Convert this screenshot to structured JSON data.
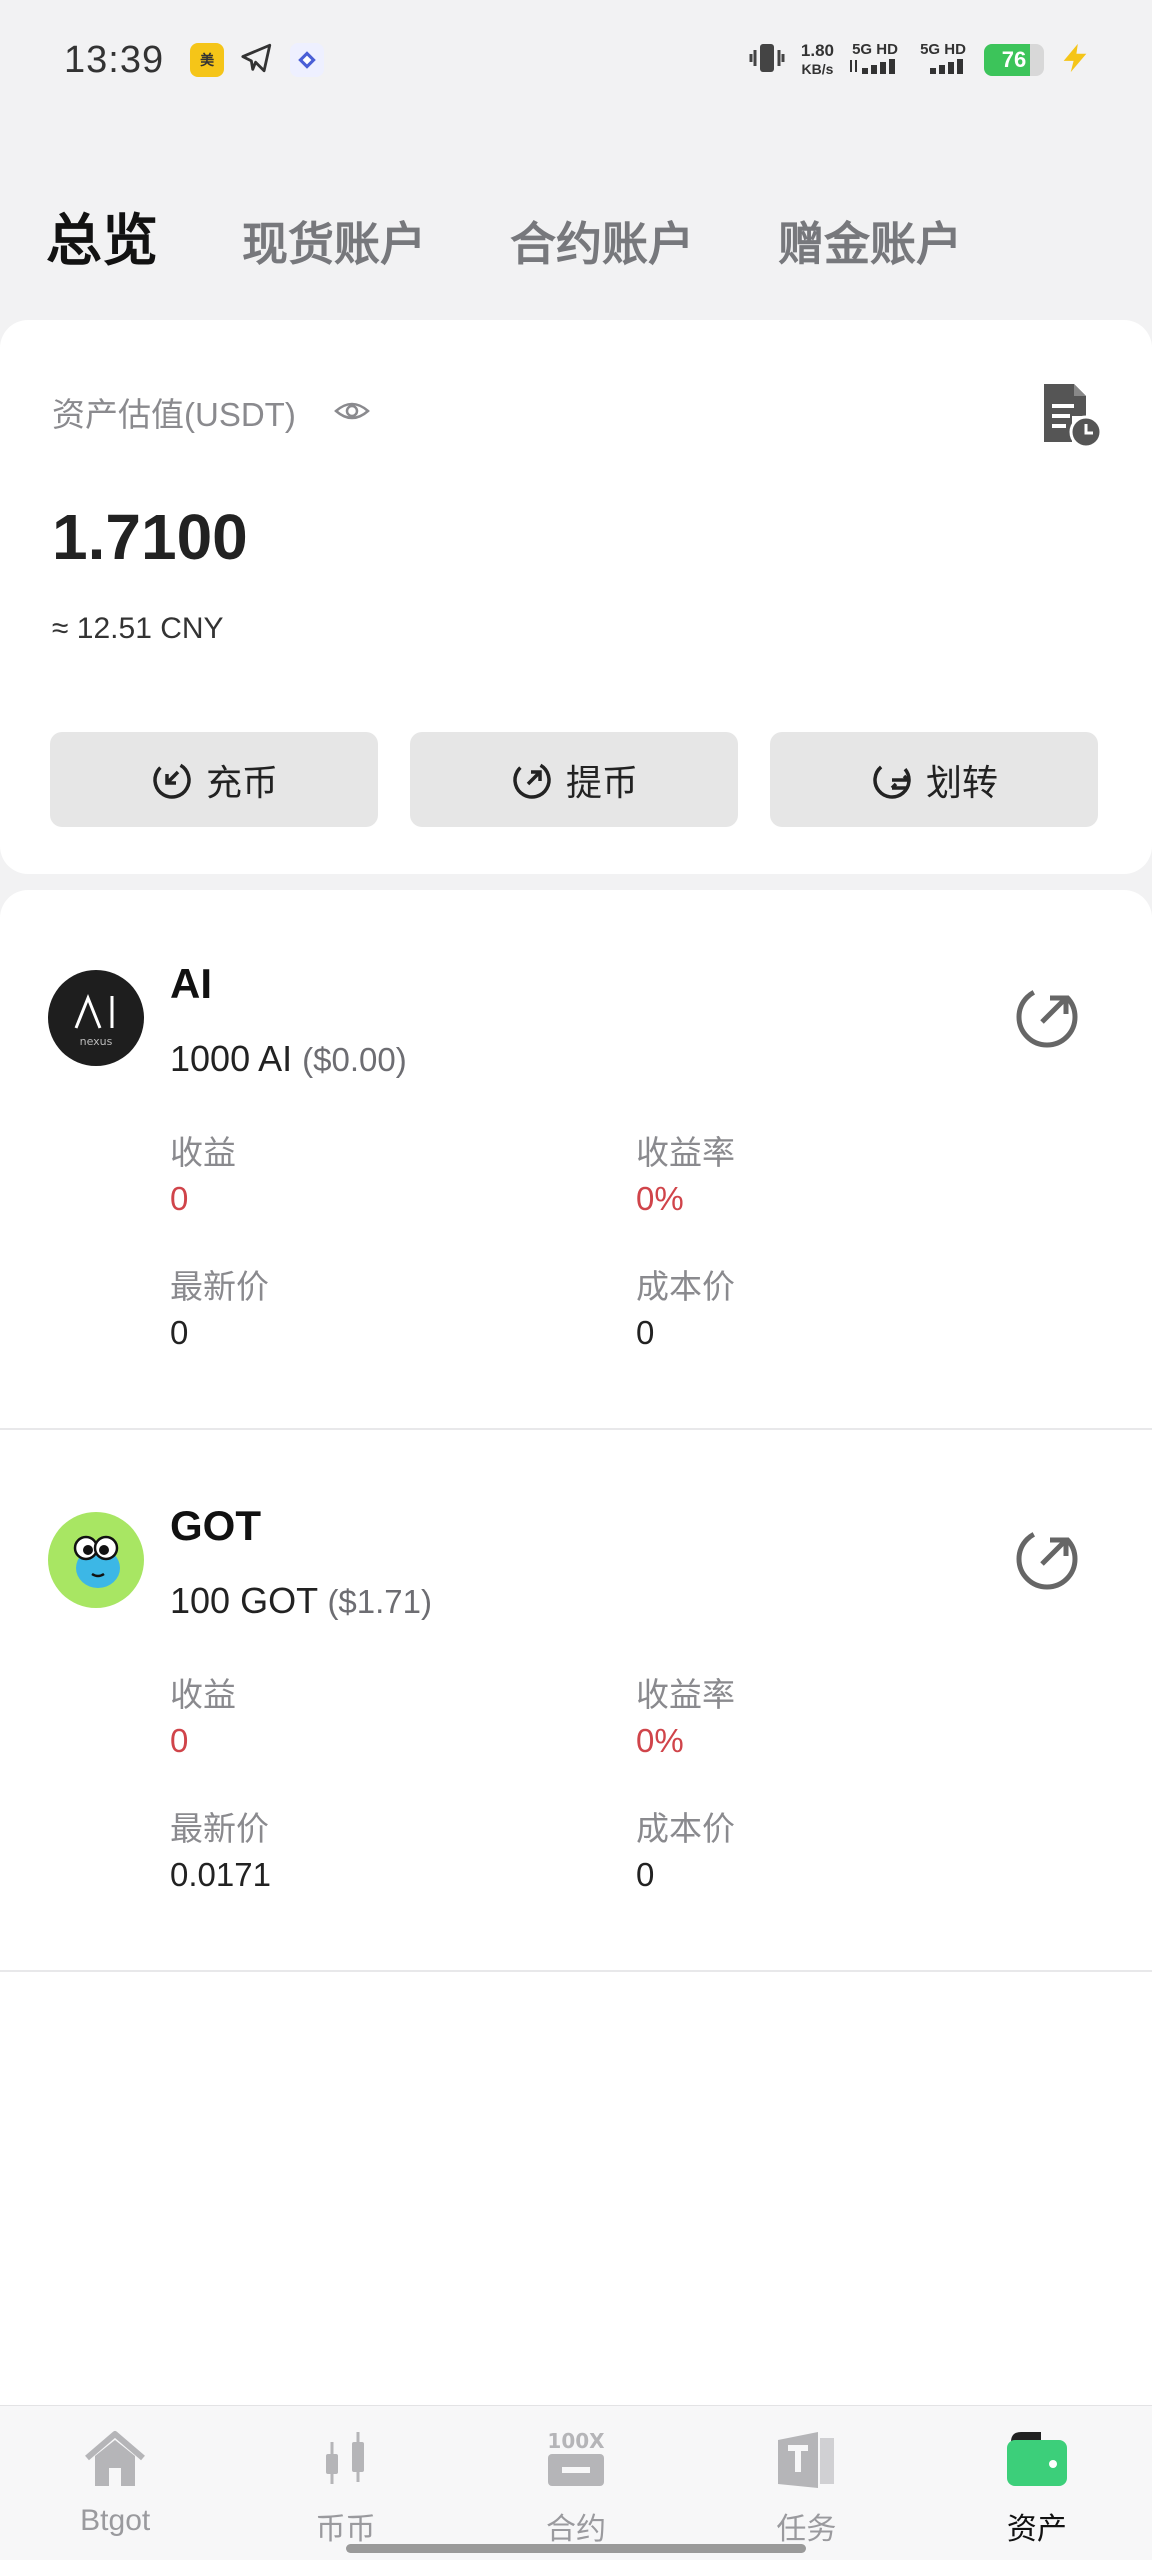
{
  "status_bar": {
    "time": "13:39",
    "speed_value": "1.80",
    "speed_unit": "KB/s",
    "network1": "5G HD",
    "network2": "5G HD",
    "battery": "76",
    "battery_level": 0.76,
    "icons": [
      "meituan-icon",
      "telegram-icon",
      "app-icon",
      "vibrate-icon",
      "charging-icon"
    ]
  },
  "tabs": [
    {
      "label": "总览",
      "active": true
    },
    {
      "label": "现货账户",
      "active": false
    },
    {
      "label": "合约账户",
      "active": false
    },
    {
      "label": "赠金账户",
      "active": false
    }
  ],
  "summary": {
    "label": "资产估值(USDT)",
    "value": "1.7100",
    "cny": "≈ 12.51 CNY",
    "actions": [
      {
        "label": "充币",
        "icon": "deposit-icon"
      },
      {
        "label": "提币",
        "icon": "withdraw-icon"
      },
      {
        "label": "划转",
        "icon": "transfer-icon"
      }
    ]
  },
  "assets": [
    {
      "name": "AI",
      "amount": "1000 AI",
      "usd": "($0.00)",
      "logo_text": "nexus",
      "profit_label": "收益",
      "profit": "0",
      "rate_label": "收益率",
      "rate": "0%",
      "price_label": "最新价",
      "price": "0",
      "cost_label": "成本价",
      "cost": "0"
    },
    {
      "name": "GOT",
      "amount": "100 GOT",
      "usd": "($1.71)",
      "profit_label": "收益",
      "profit": "0",
      "rate_label": "收益率",
      "rate": "0%",
      "price_label": "最新价",
      "price": "0.0171",
      "cost_label": "成本价",
      "cost": "0"
    }
  ],
  "bottom_nav": [
    {
      "label": "Btgot",
      "icon": "home-icon",
      "active": false
    },
    {
      "label": "币币",
      "icon": "candlestick-icon",
      "active": false
    },
    {
      "label": "合约",
      "icon": "leverage-100x-icon",
      "active": false
    },
    {
      "label": "任务",
      "icon": "task-icon",
      "active": false
    },
    {
      "label": "资产",
      "icon": "wallet-icon",
      "active": true
    }
  ],
  "colors": {
    "profit_red": "#d0444a",
    "active_green": "#3ccf7a",
    "background": "#f2f2f3"
  }
}
